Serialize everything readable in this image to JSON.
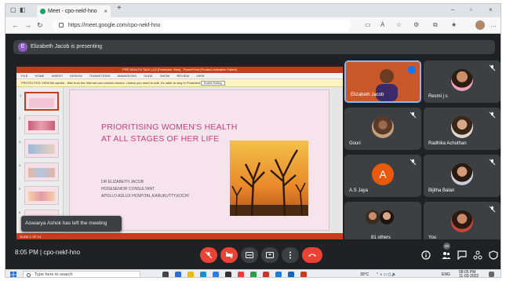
{
  "browser": {
    "tab_title": "Meet - cpo-nekf-hno",
    "new_tab_glyph": "+",
    "close_glyph": "×",
    "url": "https://meet.google.com/cpo-nekf-hno",
    "window_controls": [
      "–",
      "▫",
      "×"
    ]
  },
  "meet": {
    "presenting_initial": "E",
    "presenting_text": "Elizabeth Jacob is presenting",
    "notification": "Aiswarya Ashok has left the meeting",
    "meeting_time": "8:05 PM",
    "meeting_code": "cpo-nekf-hno",
    "people_count": "20"
  },
  "slide": {
    "ppt_title": "PRE HEALTH TALK (1)2 [Protected View] - PowerPoint (Product Activation Failed)",
    "ribbon": "FILE HOME INSERT DESIGN TRANSITIONS ANIMATIONS SLIDE SHOW REVIEW VIEW",
    "protected_view": "PROTECTED VIEW   Be careful - files from the Internet can contain viruses. Unless you need to edit, it's safer to stay in Protected View.",
    "enable_editing": "Enable Editing",
    "title_line1": "PRIORITISING  WOMEN'S HEALTH",
    "title_line2": "AT ALL STAGES OF HER LIFE",
    "author_line1": "DR ELIZABETH JACOB",
    "author_line2": "HOD&SENIOR CONSULTANT",
    "author_line3": "APOLLO ADLUX HOSPITAL,KARUKUTTY,KOCHI",
    "status_text": "SLIDE 1 OF 14"
  },
  "participants": [
    {
      "name": "Elizabeth Jacob",
      "speaking": true
    },
    {
      "name": "Resmi j s"
    },
    {
      "name": "Gouri"
    },
    {
      "name": "Radhika Achuthan"
    },
    {
      "name": "A.S Jaya",
      "initial": "A"
    },
    {
      "name": "Bijitha Balan"
    },
    {
      "name": "81 others"
    },
    {
      "name": "You"
    }
  ],
  "taskbar": {
    "search_placeholder": "Type here to search",
    "weather": "30°C",
    "language": "ENG",
    "clock_time": "08:05 PM",
    "clock_date": "11-03-2022"
  },
  "colors": {
    "meet_bg": "#202124",
    "tile_bg": "#3c4043",
    "leave_red": "#ea4335",
    "slide_pink": "#f7e3ec",
    "slide_title": "#c3417a",
    "ppt_orange": "#c43e1c"
  }
}
